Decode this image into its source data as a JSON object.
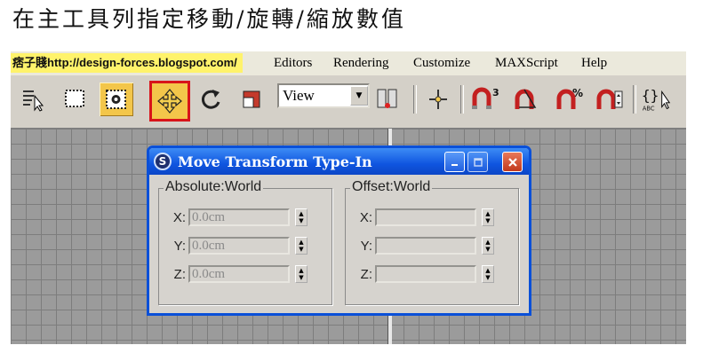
{
  "heading": "在主工具列指定移動/旋轉/縮放數值",
  "watermark": "痞子賤http://design-forces.blogspot.com/",
  "menu": {
    "items": [
      "Editors",
      "Rendering",
      "Customize",
      "MAXScript",
      "Help"
    ]
  },
  "toolbar": {
    "buttons": [
      "select-by-name-icon",
      "rectangular-selection-region-icon",
      "window-crossing-toggle-icon",
      "select-and-move-icon",
      "select-and-rotate-icon",
      "select-and-scale-icon",
      "reference-coordinate-system-dropdown",
      "use-pivot-point-center-icon",
      "select-and-manipulate-icon",
      "3d-snap-toggle-icon",
      "angle-snap-toggle-icon",
      "percent-snap-toggle-icon",
      "spinner-snap-toggle-icon",
      "edit-named-selection-sets-icon"
    ],
    "coordinate_dropdown_value": "View",
    "snap_label": "3",
    "percent_label": "%",
    "named_sets_label": "{}",
    "named_sets_sub": "ABC"
  },
  "dialog": {
    "title": "Move Transform Type-In",
    "absolute": {
      "label": "Absolute:World",
      "rows": [
        {
          "axis": "X:",
          "value": "0.0cm"
        },
        {
          "axis": "Y:",
          "value": "0.0cm"
        },
        {
          "axis": "Z:",
          "value": "0.0cm"
        }
      ]
    },
    "offset": {
      "label": "Offset:World",
      "rows": [
        {
          "axis": "X:",
          "value": ""
        },
        {
          "axis": "Y:",
          "value": ""
        },
        {
          "axis": "Z:",
          "value": ""
        }
      ]
    }
  },
  "colors": {
    "active_button": "#f3c64a",
    "highlight_border": "#d8141a",
    "titlebar": "#0f55e0",
    "close_button": "#c2391d"
  }
}
